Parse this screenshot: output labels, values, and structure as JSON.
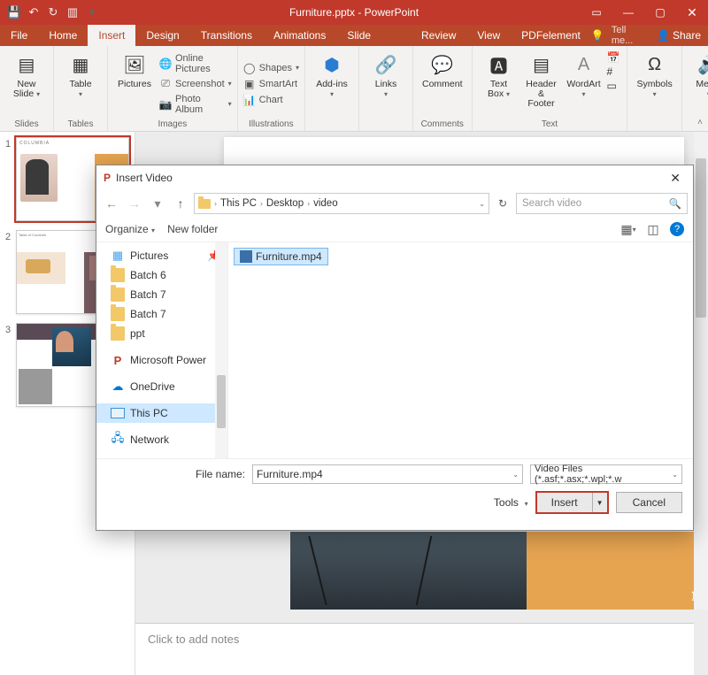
{
  "titlebar": {
    "title": "Furniture.pptx - PowerPoint"
  },
  "tabs": {
    "file": "File",
    "home": "Home",
    "insert": "Insert",
    "design": "Design",
    "transitions": "Transitions",
    "animations": "Animations",
    "slideshow": "Slide Show",
    "review": "Review",
    "view": "View",
    "pdfelement": "PDFelement",
    "tellme": "Tell me...",
    "share": "Share"
  },
  "ribbon": {
    "new_slide": "New Slide",
    "table": "Table",
    "pictures": "Pictures",
    "online_pictures": "Online Pictures",
    "screenshot": "Screenshot",
    "photo_album": "Photo Album",
    "shapes": "Shapes",
    "smartart": "SmartArt",
    "chart": "Chart",
    "addins": "Add-ins",
    "links": "Links",
    "comment": "Comment",
    "text_box": "Text Box",
    "header_footer": "Header & Footer",
    "wordart": "WordArt",
    "symbols": "Symbols",
    "media": "Media",
    "g_slides": "Slides",
    "g_tables": "Tables",
    "g_images": "Images",
    "g_illustrations": "Illustrations",
    "g_comments": "Comments",
    "g_text": "Text"
  },
  "thumbs": {
    "n1": "1",
    "n2": "2",
    "n3": "3",
    "s1_brand": "COLUMBIA",
    "s2_title": "Table of Contents"
  },
  "notes_placeholder": "Click to add notes",
  "dialog": {
    "title": "Insert Video",
    "crumbs": {
      "c1": "This PC",
      "c2": "Desktop",
      "c3": "video"
    },
    "refresh": "↻",
    "search_placeholder": "Search video",
    "organize": "Organize",
    "newfolder": "New folder",
    "nav": {
      "pictures": "Pictures",
      "b6": "Batch 6",
      "b7a": "Batch 7",
      "b7b": "Batch 7",
      "ppt": "ppt",
      "mspp": "Microsoft Power",
      "onedrive": "OneDrive",
      "thispc": "This PC",
      "network": "Network"
    },
    "file": "Furniture.mp4",
    "filename_label": "File name:",
    "filename_value": "Furniture.mp4",
    "filetype": "Video Files (*.asf;*.asx;*.wpl;*.w",
    "tools": "Tools",
    "insert": "Insert",
    "cancel": "Cancel"
  }
}
